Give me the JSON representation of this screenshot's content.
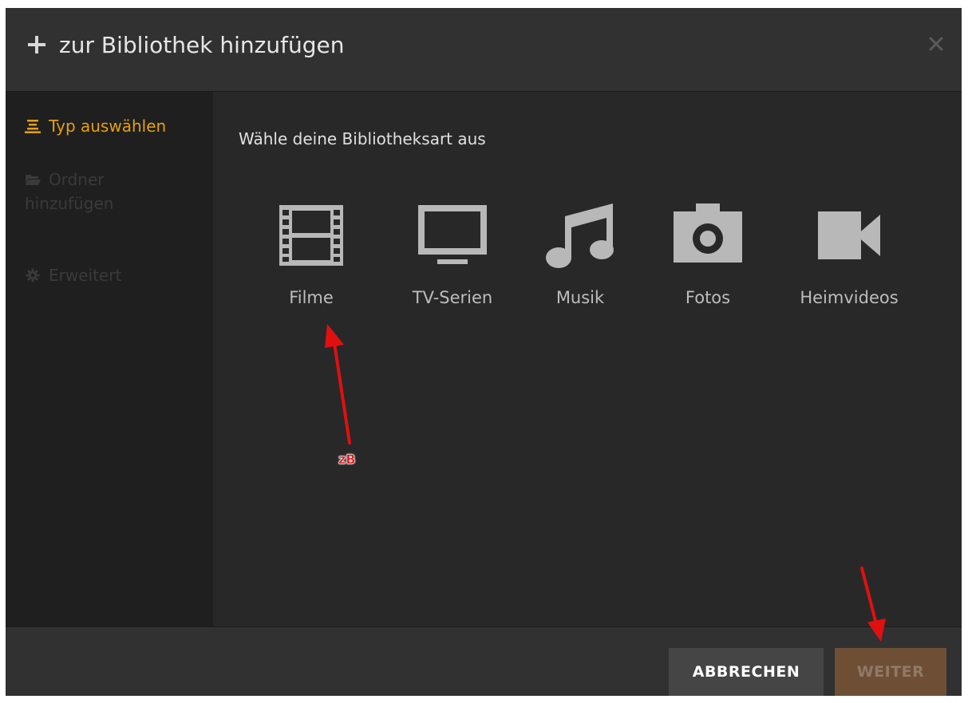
{
  "dialog": {
    "title": "zur Bibliothek hinzufügen",
    "header_icon": "plus-icon",
    "close_icon": "close-icon"
  },
  "sidebar": {
    "items": [
      {
        "label": "Typ auswählen",
        "icon": "list-icon",
        "state": "active"
      },
      {
        "label": "Ordner hinzufügen",
        "icon": "folder-open-icon",
        "state": "disabled"
      },
      {
        "label": "Erweitert",
        "icon": "gear-icon",
        "state": "disabled"
      }
    ]
  },
  "main": {
    "prompt": "Wähle deine Bibliotheksart aus",
    "library_types": [
      {
        "label": "Filme",
        "icon": "film-icon"
      },
      {
        "label": "TV-Serien",
        "icon": "tv-icon"
      },
      {
        "label": "Musik",
        "icon": "music-note-icon"
      },
      {
        "label": "Fotos",
        "icon": "camera-icon"
      },
      {
        "label": "Heimvideos",
        "icon": "video-camera-icon"
      }
    ]
  },
  "footer": {
    "cancel_label": "ABBRECHEN",
    "next_label": "WEITER"
  },
  "annotations": {
    "example_label": "zB",
    "arrow_color": "#e01010"
  },
  "colors": {
    "accent": "#e5a00d",
    "next_button_bg": "#6e4f35",
    "cancel_button_bg": "#454545"
  }
}
